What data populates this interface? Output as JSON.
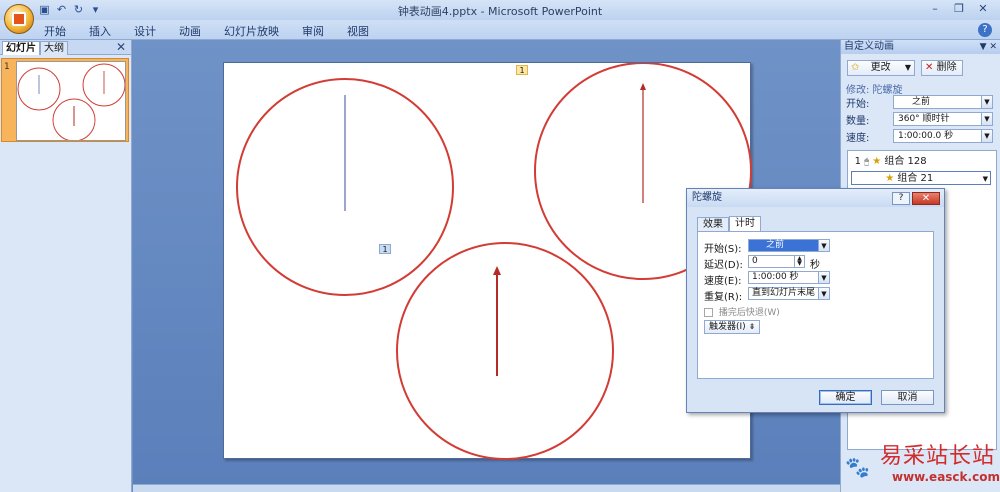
{
  "window": {
    "title": "钟表动画4.pptx - Microsoft PowerPoint",
    "qat_icons": [
      "save-icon",
      "undo-icon",
      "redo-icon",
      "customize-icon"
    ]
  },
  "ribbon": {
    "tabs": [
      "开始",
      "插入",
      "设计",
      "动画",
      "幻灯片放映",
      "审阅",
      "视图"
    ]
  },
  "left_pane": {
    "tab_slides": "幻灯片",
    "tab_outline": "大纲",
    "slide_number": "1"
  },
  "slide": {
    "tag_top": "1",
    "tag_center": "1"
  },
  "task_pane": {
    "title": "自定义动画",
    "change_button": "更改",
    "delete_button": "删除",
    "modify_label": "修改: 陀螺旋",
    "start_label": "开始:",
    "start_value": "之前",
    "amount_label": "数量:",
    "amount_value": "360°  顺时针",
    "speed_label": "速度:",
    "speed_value": "1:00:00.0 秒",
    "items": [
      {
        "index": "1",
        "label": "组合 128"
      },
      {
        "index": "",
        "label": "组合 21"
      }
    ]
  },
  "dialog": {
    "title": "陀螺旋",
    "tab_effect": "效果",
    "tab_timing": "计时",
    "start_label": "开始(S):",
    "start_value": "之前",
    "delay_label": "延迟(D):",
    "delay_value": "0",
    "delay_unit": "秒",
    "speed_label": "速度(E):",
    "speed_value": "1:00:00 秒",
    "repeat_label": "重复(R):",
    "repeat_value": "直到幻灯片末尾",
    "rewind_label": "播完后快退(W)",
    "trigger_label": "触发器(I)",
    "ok": "确定",
    "cancel": "取消"
  },
  "watermark": {
    "text": "易采站长站",
    "url": "www.easck.com"
  },
  "colors": {
    "circle": "#d23c34",
    "hand_red": "#b52b25",
    "hand_blue": "#5a6aa8"
  }
}
